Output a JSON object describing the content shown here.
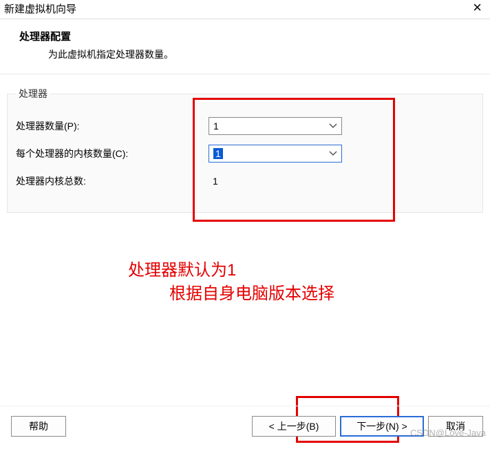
{
  "window": {
    "title": "新建虚拟机向导"
  },
  "header": {
    "title": "处理器配置",
    "description": "为此虚拟机指定处理器数量。"
  },
  "group": {
    "legend": "处理器",
    "rows": {
      "processor_count": {
        "label": "处理器数量(P):",
        "value": "1"
      },
      "cores_per_processor": {
        "label": "每个处理器的内核数量(C):",
        "value": "1"
      },
      "total_cores": {
        "label": "处理器内核总数:",
        "value": "1"
      }
    }
  },
  "annotations": {
    "line1": "处理器默认为1",
    "line2": "根据自身电脑版本选择"
  },
  "footer": {
    "help": "帮助",
    "back": "< 上一步(B)",
    "next": "下一步(N) >",
    "cancel": "取消"
  },
  "watermark": "CSDN@Love-Java"
}
